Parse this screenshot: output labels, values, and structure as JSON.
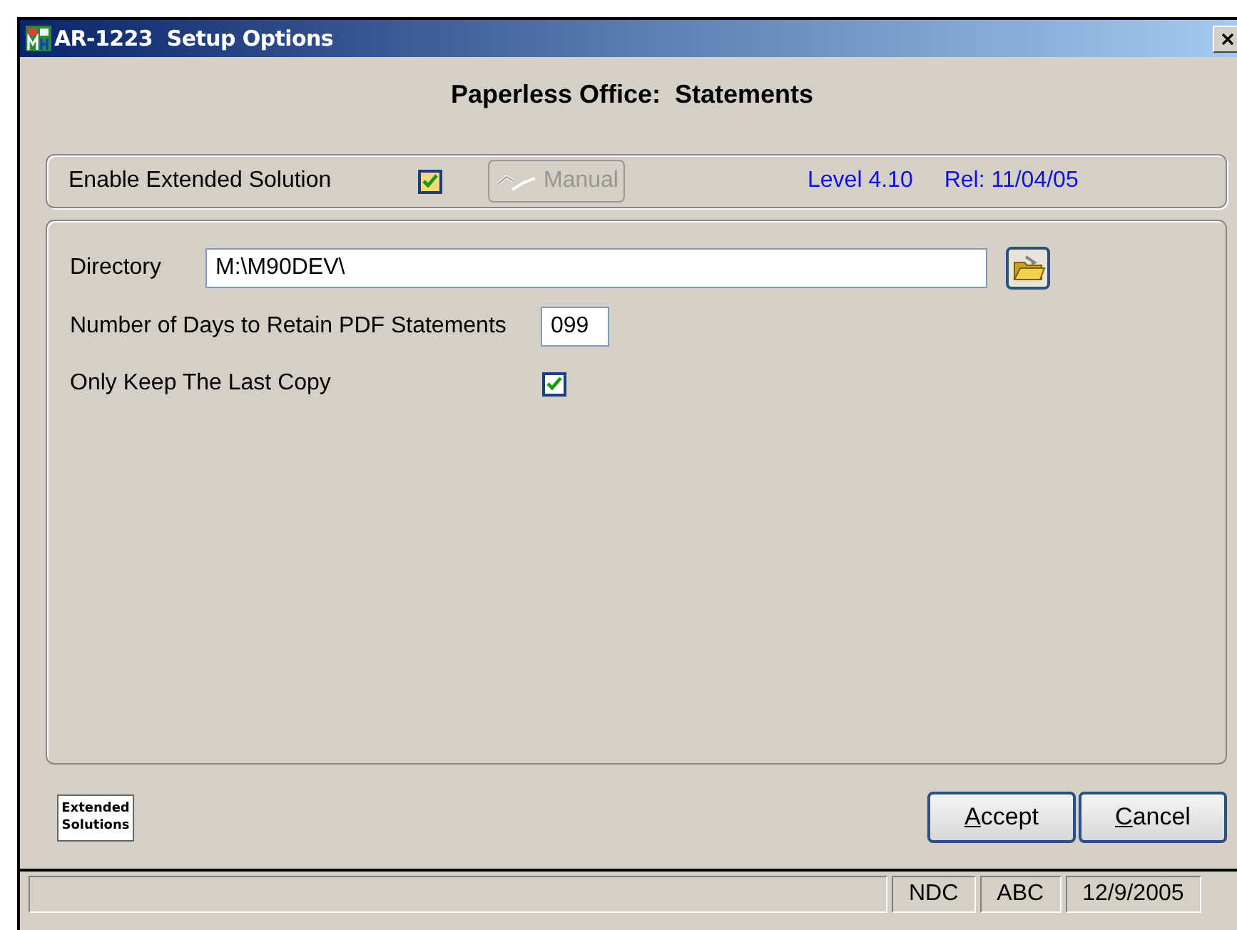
{
  "window": {
    "title": "AR-1223  Setup Options"
  },
  "heading": "Paperless Office:  Statements",
  "enable_row": {
    "label": "Enable Extended Solution",
    "checked": true,
    "manual_button": {
      "label": "Manual",
      "disabled": true
    },
    "level": "Level 4.10",
    "release": "Rel: 11/04/05"
  },
  "fields": [
    {
      "kind": "path",
      "label": "Directory",
      "value": "M:\\M90DEV\\"
    },
    {
      "kind": "number",
      "label": "Number of Days to Retain PDF Statements",
      "value": "099"
    },
    {
      "kind": "checkbox",
      "label": "Only Keep The Last Copy",
      "checked": true
    }
  ],
  "logo": [
    "Extended",
    "Solutions"
  ],
  "buttons": [
    {
      "label": "Accept"
    },
    {
      "label": "Cancel"
    }
  ],
  "status_bar": [
    "NDC",
    "ABC",
    "12/9/2005"
  ]
}
